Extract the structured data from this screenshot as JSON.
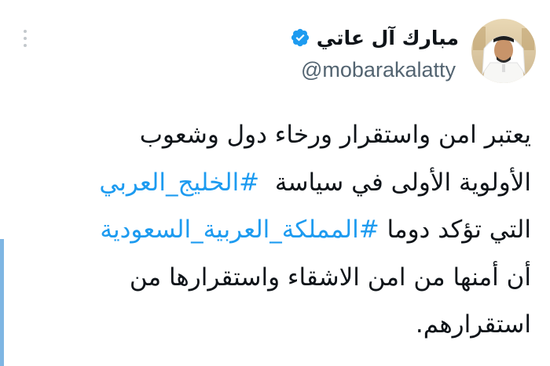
{
  "author": {
    "display_name": "مبارك آل عاتي",
    "handle": "@mobarakalatty",
    "verified": true
  },
  "icons": {
    "verified": "verified-badge-icon",
    "more": "more-vertical-icon"
  },
  "colors": {
    "hashtag": "#1d9bf0",
    "verified": "#1d9bf0",
    "text": "#0f1419",
    "handle": "#536471"
  },
  "tweet": {
    "line1": "يعتبر امن واستقرار ورخاء دول وشعوب",
    "line2_hashtag": "#الخليج_العربي",
    "line2_text": "الأولوية الأولى في سياسة",
    "line3_hashtag": "#المملكة_العربية_السعودية",
    "line3_text": "التي تؤكد دوما",
    "line4": "أن أمنها من امن الاشقاء واستقرارها من",
    "line5": "استقرارهم."
  }
}
